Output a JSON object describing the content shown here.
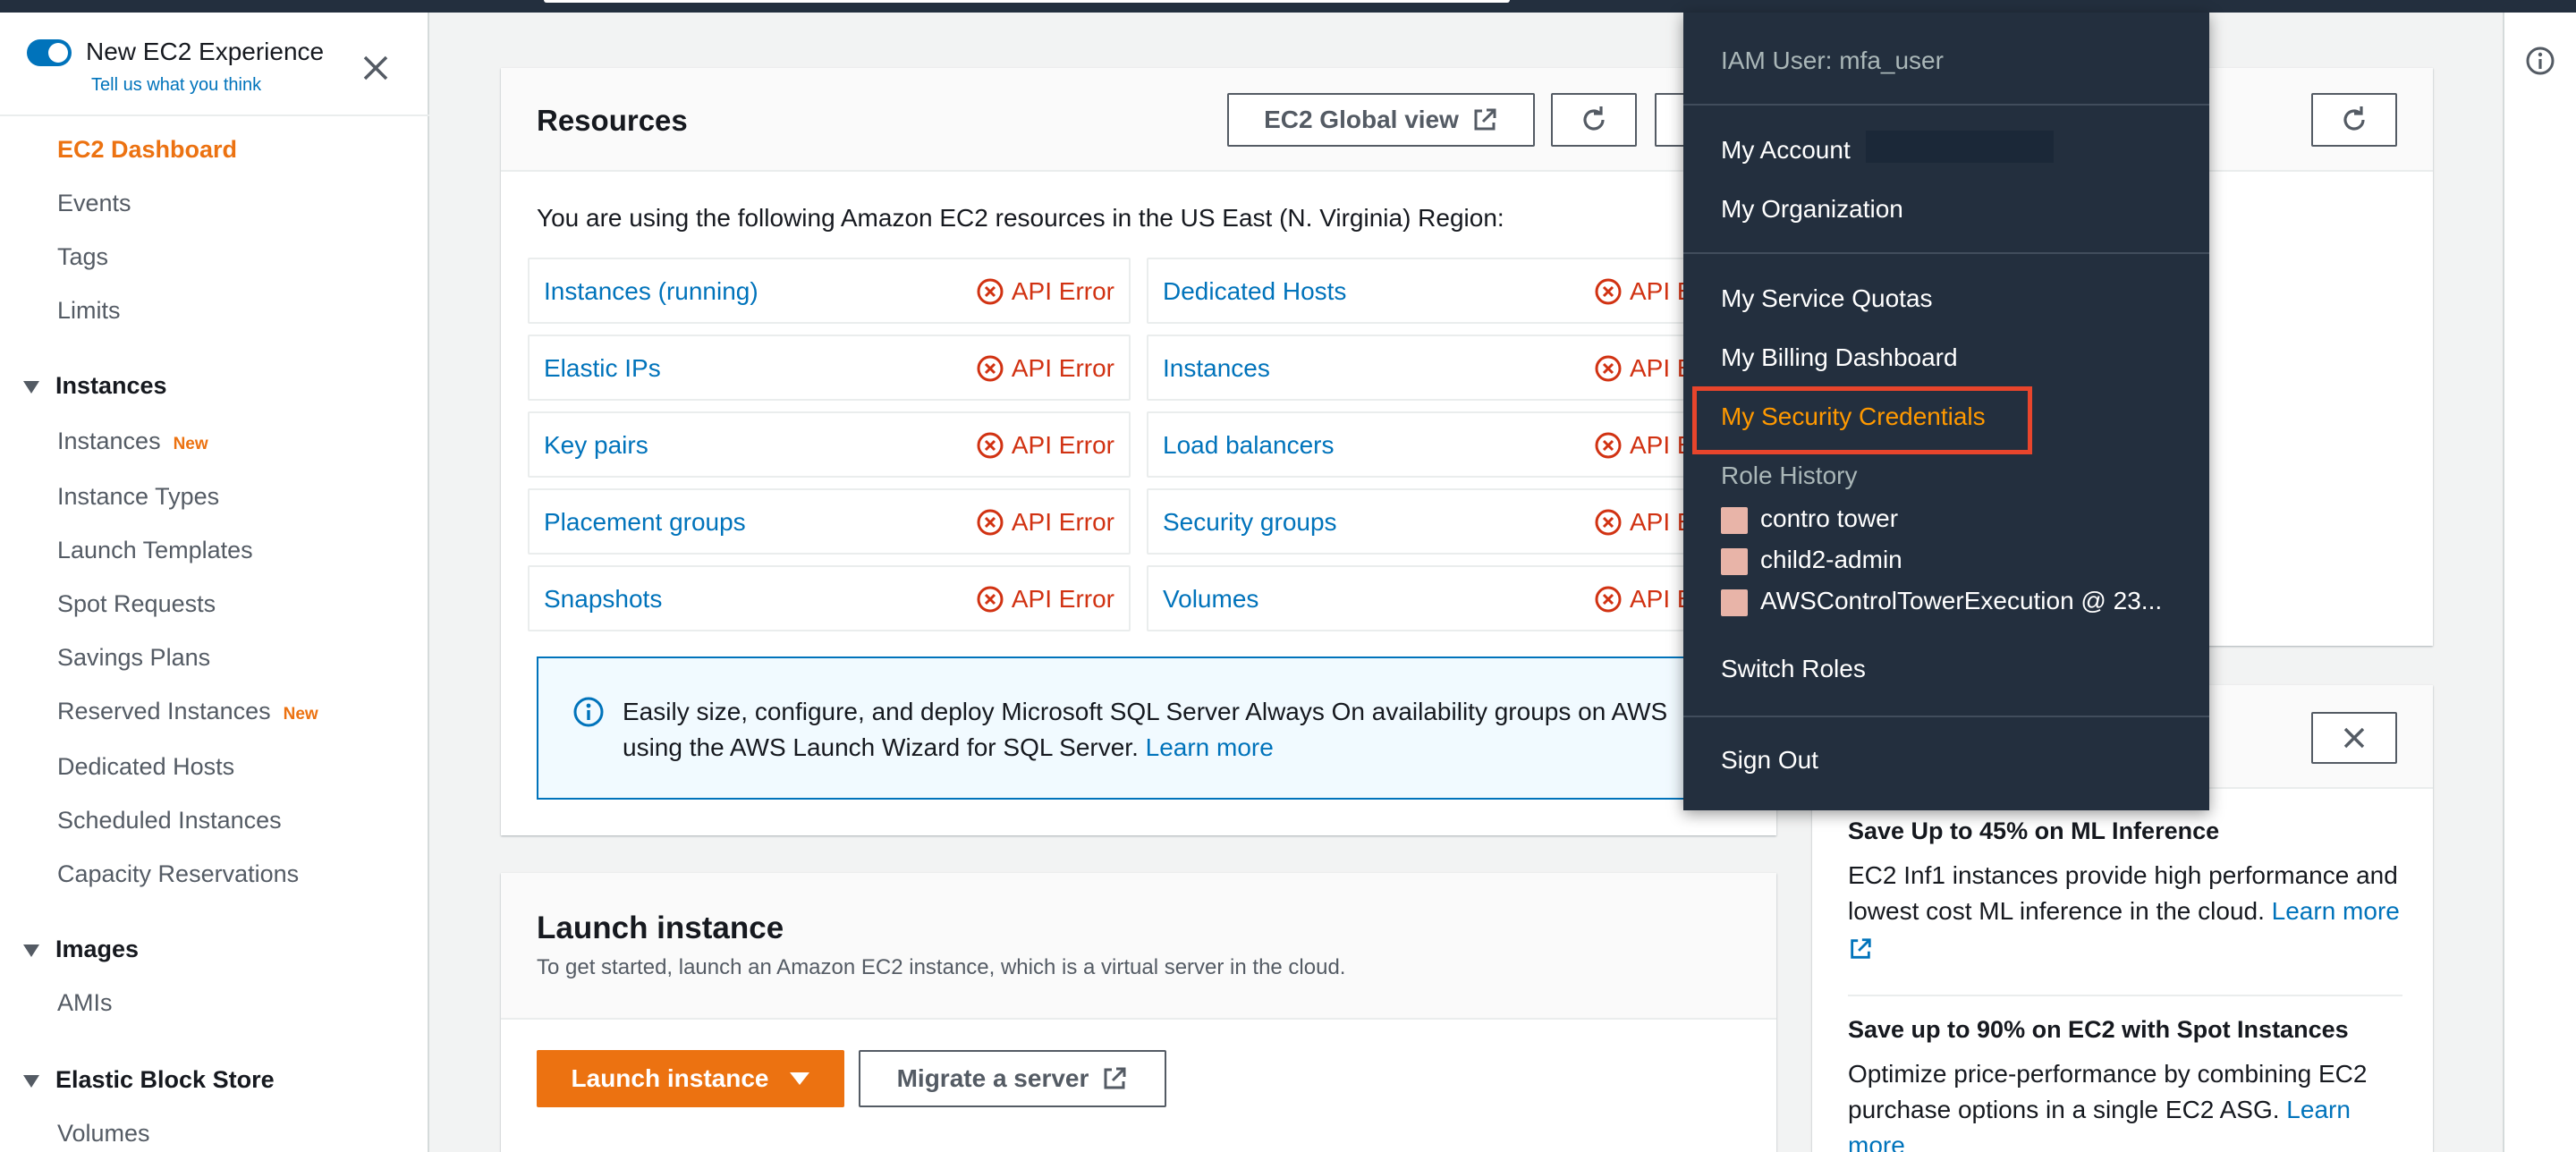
{
  "sidebar": {
    "experience_label": "New EC2 Experience",
    "feedback_link": "Tell us what you think",
    "items": [
      {
        "label": "EC2 Dashboard",
        "badge": ""
      },
      {
        "label": "Events",
        "badge": ""
      },
      {
        "label": "Tags",
        "badge": ""
      },
      {
        "label": "Limits",
        "badge": ""
      }
    ],
    "sections": [
      {
        "title": "Instances",
        "items": [
          {
            "label": "Instances",
            "badge": "New"
          },
          {
            "label": "Instance Types",
            "badge": ""
          },
          {
            "label": "Launch Templates",
            "badge": ""
          },
          {
            "label": "Spot Requests",
            "badge": ""
          },
          {
            "label": "Savings Plans",
            "badge": ""
          },
          {
            "label": "Reserved Instances",
            "badge": "New"
          },
          {
            "label": "Dedicated Hosts",
            "badge": ""
          },
          {
            "label": "Scheduled Instances",
            "badge": ""
          },
          {
            "label": "Capacity Reservations",
            "badge": ""
          }
        ]
      },
      {
        "title": "Images",
        "items": [
          {
            "label": "AMIs",
            "badge": ""
          }
        ]
      },
      {
        "title": "Elastic Block Store",
        "items": [
          {
            "label": "Volumes",
            "badge": ""
          }
        ]
      }
    ]
  },
  "resources": {
    "title": "Resources",
    "global_view_label": "EC2 Global view",
    "intro": "You are using the following Amazon EC2 resources in the US East (N. Virginia) Region:",
    "left_cells": [
      {
        "label": "Instances (running)",
        "status": "API Error"
      },
      {
        "label": "Elastic IPs",
        "status": "API Error"
      },
      {
        "label": "Key pairs",
        "status": "API Error"
      },
      {
        "label": "Placement groups",
        "status": "API Error"
      },
      {
        "label": "Snapshots",
        "status": "API Error"
      }
    ],
    "right_cells": [
      {
        "label": "Dedicated Hosts",
        "status": "API E"
      },
      {
        "label": "Instances",
        "status": "API E"
      },
      {
        "label": "Load balancers",
        "status": "API E"
      },
      {
        "label": "Security groups",
        "status": "API E"
      },
      {
        "label": "Volumes",
        "status": "API E"
      }
    ],
    "info_text": "Easily size, configure, and deploy Microsoft SQL Server Always On availability groups on AWS using the AWS Launch Wizard for SQL Server.",
    "info_link": "Learn more"
  },
  "launch": {
    "title": "Launch instance",
    "subtitle": "To get started, launch an Amazon EC2 instance, which is a virtual server in the cloud.",
    "primary_label": "Launch instance",
    "migrate_label": "Migrate a server"
  },
  "promos": [
    {
      "title": "Save Up to 45% on ML Inference",
      "text": "EC2 Inf1 instances provide high performance and lowest cost ML inference in the cloud.",
      "link": "Learn more"
    },
    {
      "title": "Save up to 90% on EC2 with Spot Instances",
      "text": "Optimize price-performance by combining EC2 purchase options in a single EC2 ASG.",
      "link": "Learn more"
    }
  ],
  "account_menu": {
    "user": "IAM User: mfa_user",
    "my_account": "My Account",
    "my_organization": "My Organization",
    "service_quotas": "My Service Quotas",
    "billing": "My Billing Dashboard",
    "security_credentials": "My Security Credentials",
    "role_history_label": "Role History",
    "roles": [
      "contro tower",
      "child2-admin",
      "AWSControlTowerExecution @ 23..."
    ],
    "switch_roles": "Switch Roles",
    "sign_out": "Sign Out"
  },
  "colors": {
    "accent_orange": "#ec7211",
    "link_blue": "#0073bb",
    "error_red": "#d13212",
    "menu_bg": "#232f3e",
    "menu_highlight": "#ff9900",
    "annotation_box": "#e8452c",
    "role_swatch": "#e8b4a8"
  }
}
